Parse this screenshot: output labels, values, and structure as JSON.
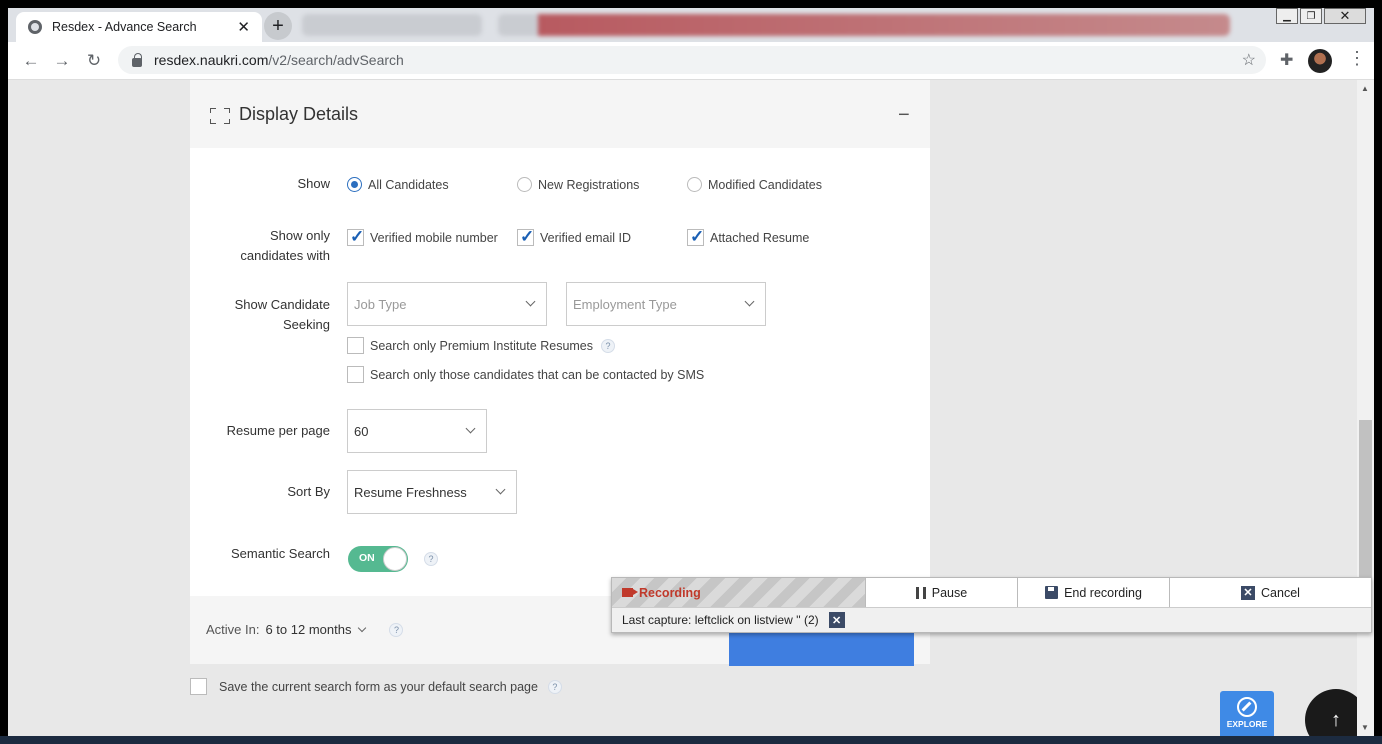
{
  "browser": {
    "tab_title": "Resdex - Advance Search",
    "url_host": "resdex.naukri.com",
    "url_path": "/v2/search/advSearch"
  },
  "section": {
    "title": "Display Details"
  },
  "show": {
    "label": "Show",
    "options": [
      "All Candidates",
      "New Registrations",
      "Modified Candidates"
    ],
    "selected": "All Candidates"
  },
  "show_only": {
    "label_line1": "Show only",
    "label_line2": "candidates with",
    "options": [
      "Verified mobile number",
      "Verified email ID",
      "Attached Resume"
    ],
    "checked": [
      true,
      true,
      true
    ]
  },
  "seeking": {
    "label_line1": "Show Candidate",
    "label_line2": "Seeking",
    "job_type_placeholder": "Job Type",
    "employment_type_placeholder": "Employment Type",
    "premium_label": "Search only Premium Institute Resumes",
    "sms_label": "Search only those candidates that can be contacted by SMS"
  },
  "resume_per_page": {
    "label": "Resume per page",
    "value": "60"
  },
  "sort_by": {
    "label": "Sort By",
    "value": "Resume Freshness"
  },
  "semantic": {
    "label": "Semantic Search",
    "toggle_text": "ON",
    "enabled": true
  },
  "footer": {
    "active_in_label": "Active In:",
    "active_in_value": "6 to 12 months",
    "save_default_label": "Save the current search form as your default search page"
  },
  "help_glyph": "?",
  "explore_label": "EXPLORE",
  "recorder": {
    "status": "Recording",
    "pause": "Pause",
    "end": "End recording",
    "cancel": "Cancel",
    "last_capture": "Last capture: leftclick on listview '' (2)"
  },
  "colors": {
    "accent": "#2c6fbf",
    "toggle_on": "#55b991",
    "recording": "#c0392b",
    "search_button": "#3f7ee0"
  }
}
